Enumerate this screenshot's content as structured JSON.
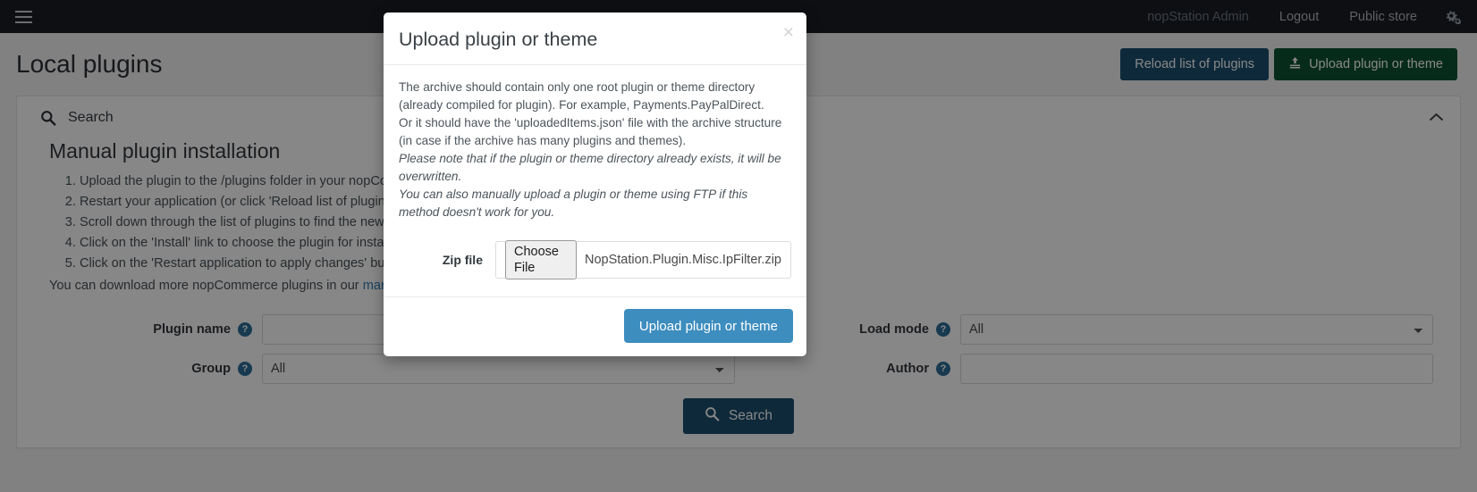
{
  "navbar": {
    "menu_icon": "hamburger-icon",
    "user": "nopStation Admin",
    "logout": "Logout",
    "public_store": "Public store",
    "gear_icon": "gears-icon"
  },
  "page": {
    "title": "Local plugins",
    "reload_button": "Reload list of plugins",
    "upload_button": "Upload plugin or theme",
    "upload_icon": "upload-icon"
  },
  "panel": {
    "search_icon": "search-icon",
    "search_title": "Search",
    "collapse_icon": "chevron-up-icon",
    "manual_title": "Manual plugin installation",
    "steps": [
      "Upload the plugin to the /plugins folder in your nopCommerce directory.",
      "Restart your application (or click 'Reload list of plugins' button).",
      "Scroll down through the list of plugins to find the newly installed plugin.",
      "Click on the 'Install' link to choose the plugin for install.",
      "Click on the 'Restart application to apply changes' button."
    ],
    "download_note_prefix": "You can download more nopCommerce plugins in our ",
    "download_note_link": "marketplace",
    "download_note_suffix": "."
  },
  "search_form": {
    "plugin_name_label": "Plugin name",
    "plugin_name_value": "",
    "plugin_name_placeholder": "",
    "load_mode_label": "Load mode",
    "load_mode_value": "All",
    "load_mode_options": [
      "All"
    ],
    "group_label": "Group",
    "group_value": "All",
    "group_options": [
      "All"
    ],
    "author_label": "Author",
    "author_value": "",
    "author_placeholder": "",
    "hint_icon": "question-mark-icon",
    "search_button": "Search",
    "search_button_icon": "search-icon"
  },
  "modal": {
    "title": "Upload plugin or theme",
    "close_label": "×",
    "close_icon": "close-icon",
    "paragraph_1": "The archive should contain only one root plugin or theme directory (already compiled for plugin). For example, Payments.PayPalDirect.",
    "paragraph_2": "Or it should have the 'uploadedItems.json' file with the archive structure (in case if the archive has many plugins and themes).",
    "paragraph_3": "Please note that if the plugin or theme directory already exists, it will be overwritten.",
    "paragraph_4": "You can also manually upload a plugin or theme using FTP if this method doesn't work for you.",
    "zip_label": "Zip file",
    "choose_file_button": "Choose File",
    "file_name": "NopStation.Plugin.Misc.IpFilter.zip",
    "submit_button": "Upload plugin or theme"
  },
  "colors": {
    "navbar_bg": "#1a1e23",
    "primary": "#1c4f6e",
    "success": "#0f5132",
    "modal_submit": "#3d8dbf",
    "link": "#2f7db5",
    "hint": "#2c6f98"
  }
}
